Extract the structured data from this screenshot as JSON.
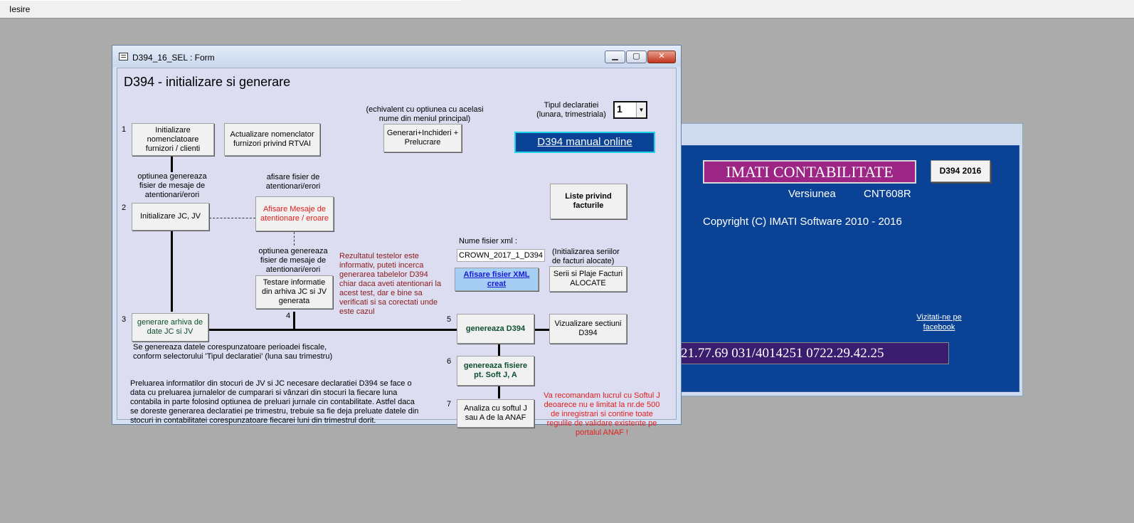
{
  "menubar": {
    "iesire": "Iesire"
  },
  "form": {
    "title": "D394_16_SEL : Form",
    "controls": {
      "min": "▁",
      "max": "▢",
      "close": "✕"
    },
    "heading": "D394 - initializare si generare",
    "equiv_note": "(echivalent cu optiunea cu acelasi nume din meniul principal)",
    "tip_label": "Tipul declaratiei (lunara, trimestriala)",
    "tip_value": "1",
    "btn_generari": "Generari+Inchideri + Prelucrare",
    "btn_manual": "D394 manual online",
    "step_numbers": {
      "n1": "1",
      "n2": "2",
      "n3": "3",
      "n4": "4",
      "n5": "5",
      "n6": "6",
      "n7": "7"
    },
    "btn_init_nomenclatoare": "Initializare nomenclatoare furnizori / clienti",
    "btn_actualizare": "Actualizare nomenclator furnizori privind RTVAI",
    "note_genereaza_1": "optiunea genereaza fisier de mesaje de atentionari/erori",
    "note_afisare_fisier": "afisare fisier de atentionari/erori",
    "btn_init_jc": "Initializare JC, JV",
    "btn_afisare_mesaje": "Afisare Mesaje de atentionare / eroare",
    "btn_liste": "Liste privind facturile",
    "note_genereaza_2": "optiunea genereaza fisier de mesaje de atentionari/erori",
    "note_rezultat": "Rezultatul testelor este informativ, puteti incerca generarea tabelelor D394 chiar daca aveti atentionari la acest test, dar e bine sa verificati si sa corectati unde este cazul",
    "xml_label": "Nume fisier xml :",
    "xml_value": "CROWN_2017_1_D394",
    "note_serii": "(Initializarea seriilor de facturi alocate)",
    "btn_afisare_xml": "Afisare fisier XML creat",
    "btn_serii": "Serii si Plaje Facturi ALOCATE",
    "btn_testare": "Testare informatie din arhiva JC si JV generata",
    "btn_generare_arhiva": "generare arhiva de date JC si JV",
    "btn_genereaza_d394": "genereaza D394",
    "btn_vizualizare": "Vizualizare sectiuni D394",
    "note_perioada": "Se genereaza datele corespunzatoare perioadei fiscale, conform selectorului 'Tipul declaratiei' (luna sau trimestru)",
    "btn_genereaza_fisiere": "genereaza fisiere pt. Soft J, A",
    "note_preluare": "Preluarea informatilor din stocuri de JV si JC  necesare declaratiei D394 se face o data cu preluarea jurnalelor de cumparari si vânzari din stocuri la fiecare luna contabila in parte folosind optiunea de preluari jurnale cin contabilitate. Astfel daca se doreste generarea declaratiei pe trimestru, trebuie sa fie deja preluate datele din stocuri in contabilitatei corespunzatoare fiecarei luni din trimestrul dorit.",
    "btn_analiza": "Analiza cu softul J sau A de la ANAF",
    "note_recomandam": "Va recomandam lucrul cu Softul J deoarece nu e limitat la nr.de 500 de inregistrari si contine toate regulile de validare existente pe portalul ANAF !"
  },
  "background_window": {
    "brand": "IMATI CONTABILITATE",
    "btn_d394_2016": "D394  2016",
    "versiunea_label": "Versiunea",
    "versiunea_value": "CNT608R",
    "copyright": "Copyright (C)  IMATI Software 2010 - 2016",
    "vizitati": "Vizitati-ne pe facebook",
    "phones": "21.77.69   031/4014251   0722.29.42.25"
  },
  "colors": {
    "brand_bg": "#9c2585",
    "panel_blue": "#0a4396",
    "phone_bg": "#3a1d6e",
    "warn_red": "#e0201c"
  }
}
